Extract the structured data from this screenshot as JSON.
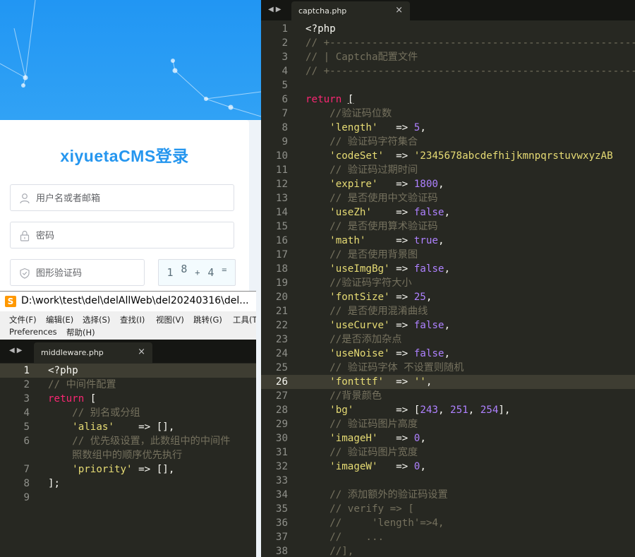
{
  "login": {
    "title": "xiyuetaCMS登录",
    "username_placeholder": "用户名或者邮箱",
    "password_placeholder": "密码",
    "captcha_placeholder": "图形验证码",
    "captcha_chars": [
      "1",
      "8",
      "+",
      "4",
      "="
    ]
  },
  "editor_left": {
    "window_title": "D:\\work\\test\\del\\delAllWeb\\del20240316\\del...",
    "menu": [
      "文件(F)",
      "编辑(E)",
      "选择(S)",
      "查找(I)",
      "视图(V)",
      "跳转(G)",
      "工具(T)",
      "Preferences",
      "帮助(H)"
    ],
    "tab_label": "middleware.php",
    "current_line": 1
  },
  "editor_right": {
    "tab_label": "captcha.php",
    "current_line": 26
  },
  "colors": {
    "keyword": "#f92672",
    "string": "#e6db74",
    "number": "#ae81ff",
    "comment": "#75715e",
    "background": "#272822",
    "login_accent": "#2596ef"
  }
}
